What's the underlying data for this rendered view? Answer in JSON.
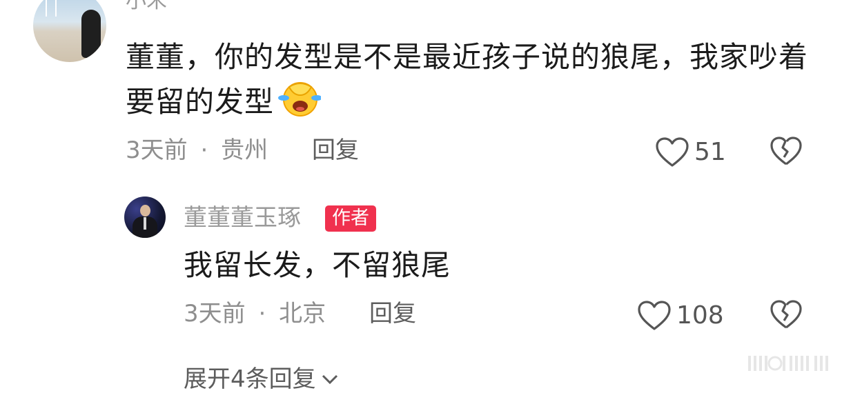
{
  "comment": {
    "author": "小禾",
    "text": "董董，你的发型是不是最近孩子说的狼尾，我家吵着要留的发型",
    "emoji": "laughing-face-emoji",
    "time": "3天前",
    "separator": "·",
    "location": "贵州",
    "reply_label": "回复",
    "like_count": "51"
  },
  "reply": {
    "author": "董董董玉琢",
    "badge": "作者",
    "text": "我留长发，不留狼尾",
    "time": "3天前",
    "separator": "·",
    "location": "北京",
    "reply_label": "回复",
    "like_count": "108"
  },
  "expand": {
    "label": "展开4条回复",
    "icon": "chevron-down-icon"
  },
  "colors": {
    "badge_bg": "#f0314e",
    "text": "#1b1b1b",
    "meta": "#8e8e8e"
  }
}
